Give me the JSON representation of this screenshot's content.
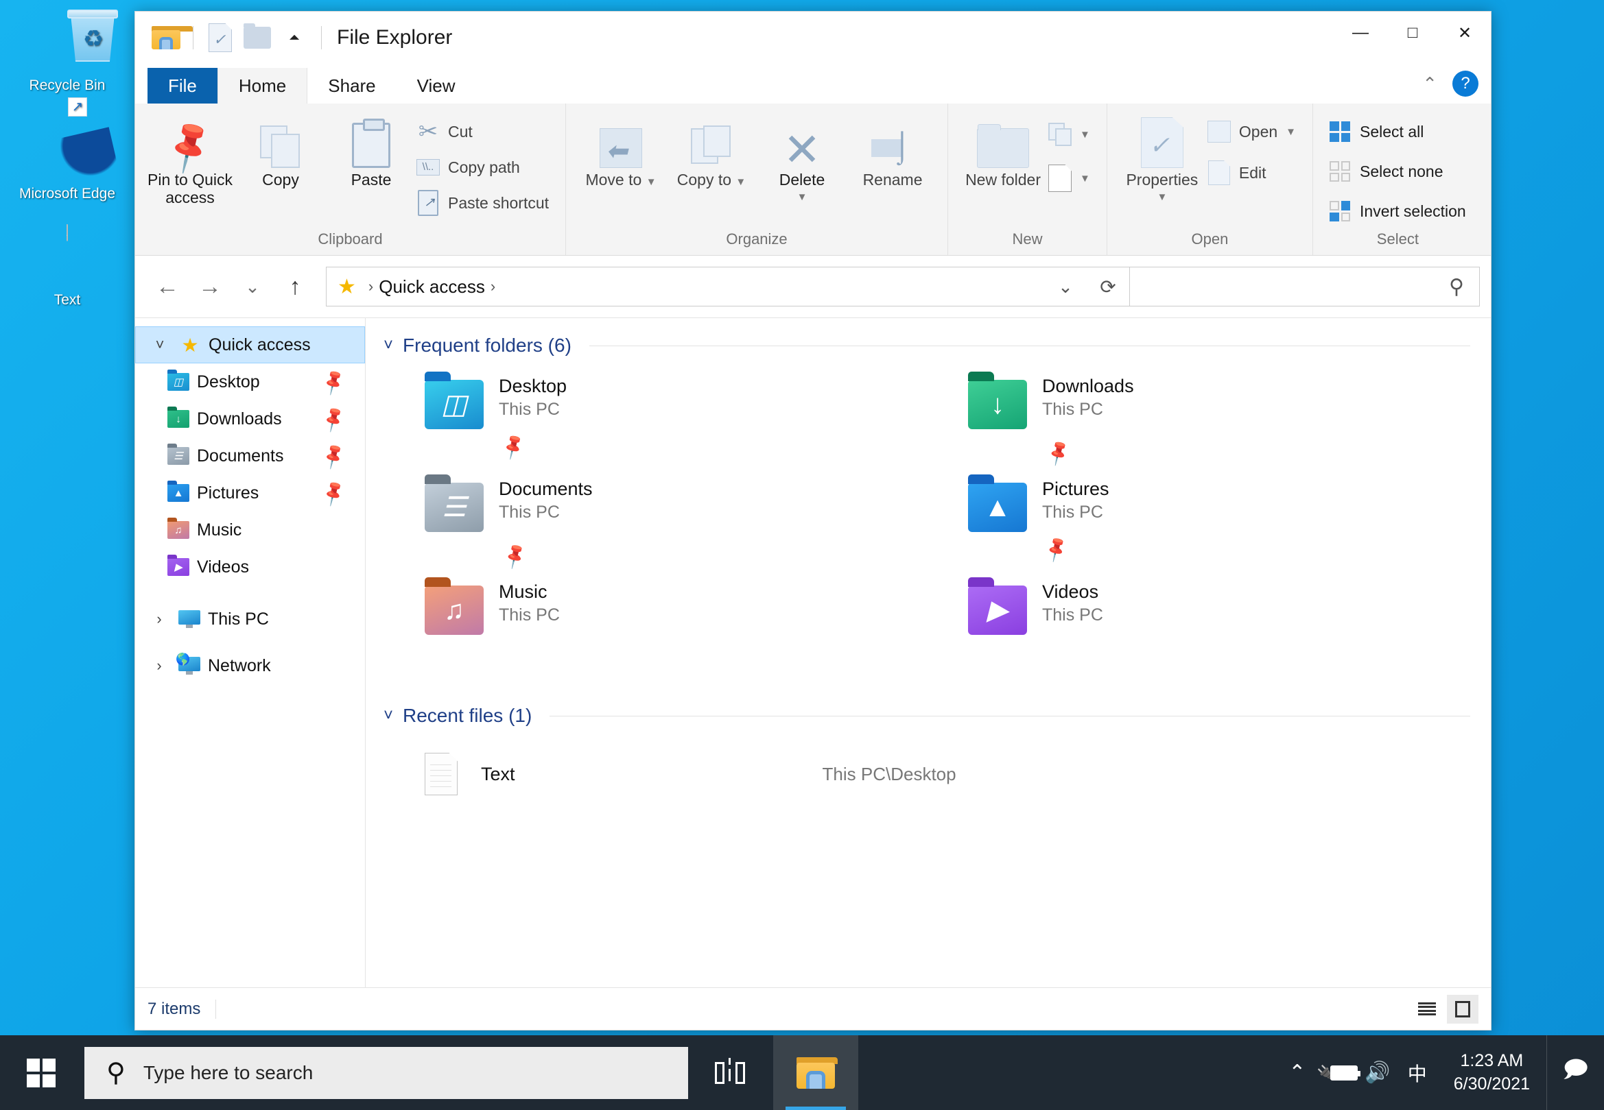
{
  "desktop": {
    "icons": [
      {
        "label": "Recycle Bin",
        "icon": "recycle-bin-icon"
      },
      {
        "label": "Microsoft Edge",
        "icon": "microsoft-edge-icon"
      },
      {
        "label": "Text",
        "icon": "text-file-icon"
      }
    ]
  },
  "window": {
    "title": "File Explorer",
    "quick_access_toolbar": [
      {
        "icon": "file-explorer-icon",
        "name": "file-explorer-icon"
      },
      {
        "icon": "properties-icon",
        "name": "qat-properties-icon"
      },
      {
        "icon": "new-folder-icon",
        "name": "qat-new-folder-icon"
      },
      {
        "icon": "chevron-down-icon",
        "name": "qat-customize-icon"
      }
    ],
    "controls": {
      "minimize": "—",
      "maximize": "□",
      "close": "✕",
      "collapse_ribbon": "⌃",
      "help": "?"
    }
  },
  "tabs": [
    {
      "label": "File",
      "state": "file"
    },
    {
      "label": "Home",
      "state": "active"
    },
    {
      "label": "Share",
      "state": "normal"
    },
    {
      "label": "View",
      "state": "normal"
    }
  ],
  "ribbon": {
    "groups": [
      {
        "title": "Clipboard",
        "big_buttons": [
          {
            "label": "Pin to Quick access",
            "icon": "pin-icon",
            "enabled": true
          },
          {
            "label": "Copy",
            "icon": "copy-icon",
            "enabled": true
          },
          {
            "label": "Paste",
            "icon": "paste-icon",
            "enabled": true
          }
        ],
        "small_buttons": [
          {
            "label": "Cut",
            "icon": "scissors-icon"
          },
          {
            "label": "Copy path",
            "icon": "copy-path-icon"
          },
          {
            "label": "Paste shortcut",
            "icon": "paste-shortcut-icon"
          }
        ]
      },
      {
        "title": "Organize",
        "big_buttons": [
          {
            "label": "Move to",
            "icon": "move-to-icon",
            "caret": true
          },
          {
            "label": "Copy to",
            "icon": "copy-to-icon",
            "caret": true
          },
          {
            "label": "Delete",
            "icon": "delete-icon",
            "caret": true,
            "enabled": true
          },
          {
            "label": "Rename",
            "icon": "rename-icon"
          }
        ]
      },
      {
        "title": "New",
        "big_buttons": [
          {
            "label": "New folder",
            "icon": "new-folder-icon"
          }
        ],
        "small_buttons": [
          {
            "label": "",
            "icon": "new-item-icon",
            "caret": true
          },
          {
            "label": "",
            "icon": "easy-access-icon",
            "caret": true
          }
        ]
      },
      {
        "title": "Open",
        "big_buttons": [
          {
            "label": "Properties",
            "icon": "properties-icon",
            "caret": true
          }
        ],
        "small_buttons": [
          {
            "label": "Open",
            "icon": "open-icon",
            "caret": true
          },
          {
            "label": "Edit",
            "icon": "edit-icon"
          }
        ]
      },
      {
        "title": "Select",
        "small_buttons": [
          {
            "label": "Select all",
            "icon": "select-all-icon"
          },
          {
            "label": "Select none",
            "icon": "select-none-icon"
          },
          {
            "label": "Invert selection",
            "icon": "invert-selection-icon"
          }
        ]
      }
    ]
  },
  "address_bar": {
    "back_icon": "back-arrow-icon",
    "forward_icon": "forward-arrow-icon",
    "recent_icon": "chevron-down-icon",
    "up_icon": "up-arrow-icon",
    "location_icon": "star-icon",
    "breadcrumb": [
      "Quick access"
    ],
    "separator": "›",
    "dropdown_icon": "chevron-down-icon",
    "refresh_icon": "refresh-icon",
    "search_placeholder": "",
    "search_icon": "search-icon"
  },
  "nav_pane": {
    "items": [
      {
        "label": "Quick access",
        "icon": "star-icon",
        "chevron": "˅",
        "selected": true,
        "level": 0
      },
      {
        "label": "Desktop",
        "icon": "folder-desktop-icon",
        "pinned": true,
        "level": 1
      },
      {
        "label": "Downloads",
        "icon": "folder-downloads-icon",
        "pinned": true,
        "level": 1
      },
      {
        "label": "Documents",
        "icon": "folder-documents-icon",
        "pinned": true,
        "level": 1
      },
      {
        "label": "Pictures",
        "icon": "folder-pictures-icon",
        "pinned": true,
        "level": 1
      },
      {
        "label": "Music",
        "icon": "folder-music-icon",
        "pinned": false,
        "level": 1
      },
      {
        "label": "Videos",
        "icon": "folder-videos-icon",
        "pinned": false,
        "level": 1
      },
      {
        "label": "This PC",
        "icon": "this-pc-icon",
        "chevron": "›",
        "level": 0
      },
      {
        "label": "Network",
        "icon": "network-icon",
        "chevron": "›",
        "level": 0
      }
    ]
  },
  "content": {
    "frequent_folders": {
      "title": "Frequent folders (6)",
      "chevron": "˅",
      "items": [
        {
          "name": "Desktop",
          "location": "This PC",
          "icon": "folder-desktop-icon",
          "glyph": "▤",
          "pinned": true
        },
        {
          "name": "Downloads",
          "location": "This PC",
          "icon": "folder-downloads-icon",
          "glyph": "⬇",
          "pinned": true
        },
        {
          "name": "Documents",
          "location": "This PC",
          "icon": "folder-documents-icon",
          "glyph": "☰",
          "pinned": true
        },
        {
          "name": "Pictures",
          "location": "This PC",
          "icon": "folder-pictures-icon",
          "glyph": "▲",
          "pinned": true
        },
        {
          "name": "Music",
          "location": "This PC",
          "icon": "folder-music-icon",
          "glyph": "♫",
          "pinned": false
        },
        {
          "name": "Videos",
          "location": "This PC",
          "icon": "folder-videos-icon",
          "glyph": "▶",
          "pinned": false
        }
      ]
    },
    "recent_files": {
      "title": "Recent files (1)",
      "chevron": "˅",
      "items": [
        {
          "name": "Text",
          "path": "This PC\\Desktop",
          "icon": "text-file-icon"
        }
      ]
    }
  },
  "status_bar": {
    "item_count": "7 items",
    "views": [
      {
        "icon": "details-view-icon",
        "active": false
      },
      {
        "icon": "large-icons-view-icon",
        "active": true
      }
    ]
  },
  "taskbar": {
    "start_icon": "windows-start-icon",
    "search_placeholder": "Type here to search",
    "search_icon": "search-icon",
    "buttons": [
      {
        "icon": "task-view-icon",
        "name": "task-view-button",
        "active": false
      },
      {
        "icon": "file-explorer-icon",
        "name": "taskbar-file-explorer",
        "active": true
      },
      {
        "icon": "microsoft-edge-icon",
        "name": "taskbar-edge",
        "active": false
      }
    ],
    "tray": [
      {
        "icon": "show-hidden-icons-chevron",
        "glyph": "⌃"
      },
      {
        "icon": "battery-charging-icon",
        "glyph": ""
      },
      {
        "icon": "volume-icon",
        "glyph": "🔊"
      },
      {
        "icon": "ime-language-icon",
        "glyph": "中"
      }
    ],
    "clock": {
      "time": "1:23 AM",
      "date": "6/30/2021"
    },
    "notification_icon": "action-center-icon"
  }
}
